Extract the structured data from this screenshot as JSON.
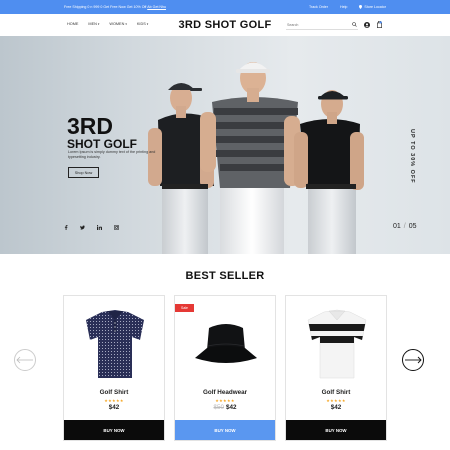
{
  "topbar": {
    "promo_text": "Free Shipping 0 n 999 0 Get Free Now Get 10% Off",
    "promo_link": "Ab Get Nhu",
    "track_order": "Track Order",
    "help": "Help",
    "store_locator": "Store Locator"
  },
  "header": {
    "nav": [
      "HOME",
      "MEN",
      "WOMEN",
      "KIDS"
    ],
    "logo": "3RD SHOT GOLF",
    "search_placeholder": "Search"
  },
  "hero": {
    "title_line1": "3RD",
    "title_line2": "SHOT GOLF",
    "description": "Lorem Ipsum is simply dummy text of the printing and typesetting industry.",
    "shop_button": "Shop Now",
    "side_text": "UP TO 30% OFF",
    "pager_current": "01",
    "pager_total": "05",
    "social_icons": [
      "facebook-icon",
      "twitter-icon",
      "linkedin-icon",
      "instagram-icon"
    ]
  },
  "best_seller": {
    "title": "BEST SELLER",
    "products": [
      {
        "name": "Golf Shirt",
        "rating_stars": "★★★★★",
        "price": "$42",
        "old_price": "",
        "badge": "",
        "button": "BUY NOW",
        "highlight": false
      },
      {
        "name": "Golf Headwear",
        "rating_stars": "★★★★★",
        "price": "$42",
        "old_price": "$50",
        "badge": "Sale",
        "button": "BUY NOW",
        "highlight": true
      },
      {
        "name": "Golf Shirt",
        "rating_stars": "★★★★★",
        "price": "$42",
        "old_price": "",
        "badge": "",
        "button": "BUY NOW",
        "highlight": false
      }
    ]
  },
  "colors": {
    "topbar": "#4f8ef0",
    "buy_button": "#0b0b0b",
    "buy_button_highlight": "#5a97f0",
    "sale_badge": "#e53935",
    "stars": "#f5a623"
  }
}
